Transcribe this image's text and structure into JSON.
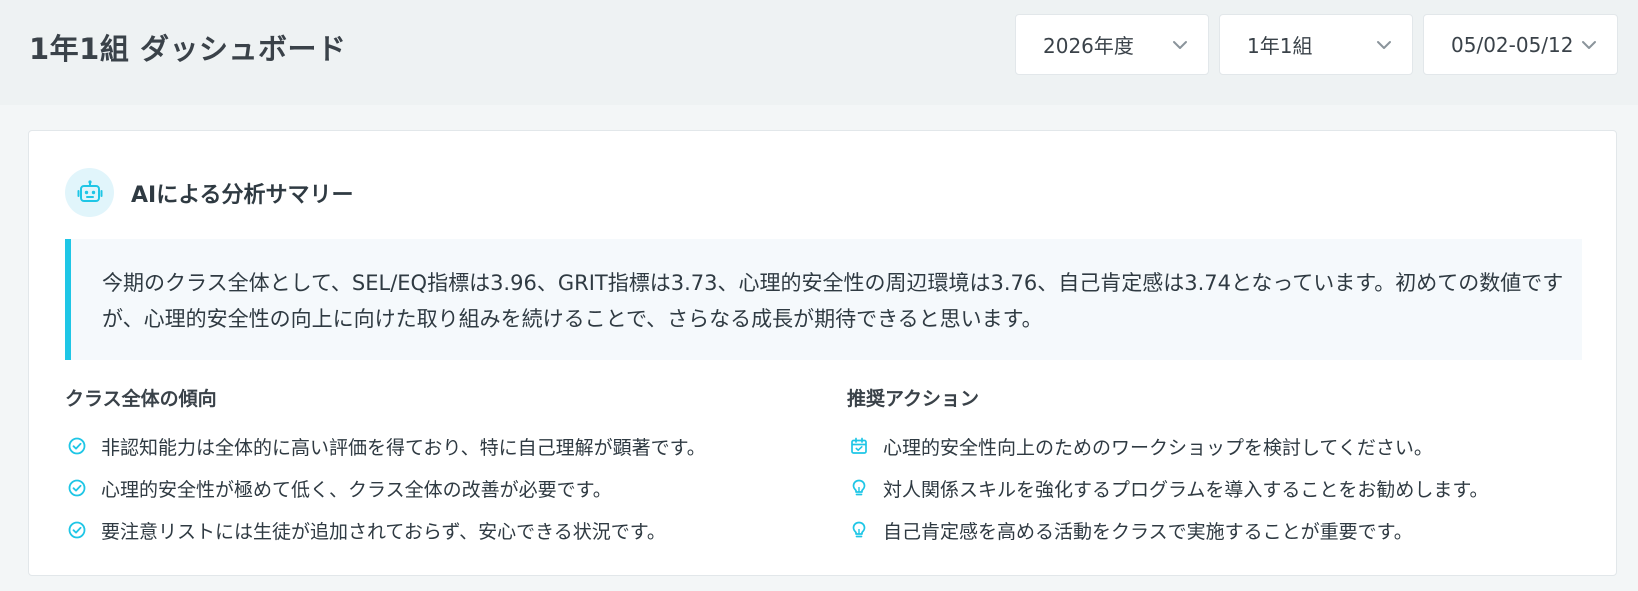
{
  "header": {
    "title": "1年1組 ダッシュボード",
    "year_select": "2026年度",
    "class_select": "1年1組",
    "period_select": "05/02-05/12"
  },
  "summary_card": {
    "title": "AIによる分析サマリー",
    "summary_text": "今期のクラス全体として、SEL/EQ指標は3.96、GRIT指標は3.73、心理的安全性の周辺環境は3.76、自己肯定感は3.74となっています。初めての数値ですが、心理的安全性の向上に向けた取り組みを続けることで、さらなる成長が期待できると思います。",
    "trends": {
      "title": "クラス全体の傾向",
      "items": [
        {
          "icon": "check-circle-icon",
          "text": "非認知能力は全体的に高い評価を得ており、特に自己理解が顕著です。"
        },
        {
          "icon": "check-circle-icon",
          "text": "心理的安全性が極めて低く、クラス全体の改善が必要です。"
        },
        {
          "icon": "check-circle-icon",
          "text": "要注意リストには生徒が追加されておらず、安心できる状況です。"
        }
      ]
    },
    "actions": {
      "title": "推奨アクション",
      "items": [
        {
          "icon": "calendar-check-icon",
          "text": "心理的安全性向上のためのワークショップを検討してください。"
        },
        {
          "icon": "lightbulb-icon",
          "text": "対人関係スキルを強化するプログラムを導入することをお勧めします。"
        },
        {
          "icon": "lightbulb-icon",
          "text": "自己肯定感を高める活動をクラスで実施することが重要です。"
        }
      ]
    }
  },
  "colors": {
    "accent": "#1ec6e6",
    "background": "#f3f6f7",
    "text": "#2f3a42"
  }
}
